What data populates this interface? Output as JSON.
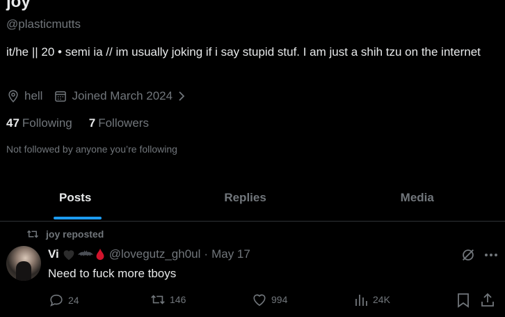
{
  "profile": {
    "display_name": "joy",
    "handle": "@plasticmutts",
    "bio": "it/he || 20 • semi ia // im usually joking if i say stupid stuf. I am just a shih tzu on the internet",
    "location": "hell",
    "joined": "Joined March 2024",
    "following_count": "47",
    "following_label": "Following",
    "followers_count": "7",
    "followers_label": "Followers",
    "not_followed_note": "Not followed by anyone you’re following"
  },
  "tabs": [
    {
      "label": "Posts",
      "active": true
    },
    {
      "label": "Replies",
      "active": false
    },
    {
      "label": "Media",
      "active": false
    }
  ],
  "post": {
    "repost_by": "joy reposted",
    "author_name": "Vi",
    "author_emojis": [
      "black-heart-icon",
      "bat-icon",
      "blood-drop-icon"
    ],
    "author_handle": "@lovegutz_gh0ul",
    "separator": "·",
    "date": "May 17",
    "text": "Need to fuck more tboys",
    "stats": {
      "replies": "24",
      "reposts": "146",
      "likes": "994",
      "views": "24K"
    }
  },
  "colors": {
    "background": "#000000",
    "primary_text": "#e7e9ea",
    "secondary_text": "#71767b",
    "accent": "#1d9bf0",
    "divider": "#2f3336"
  }
}
